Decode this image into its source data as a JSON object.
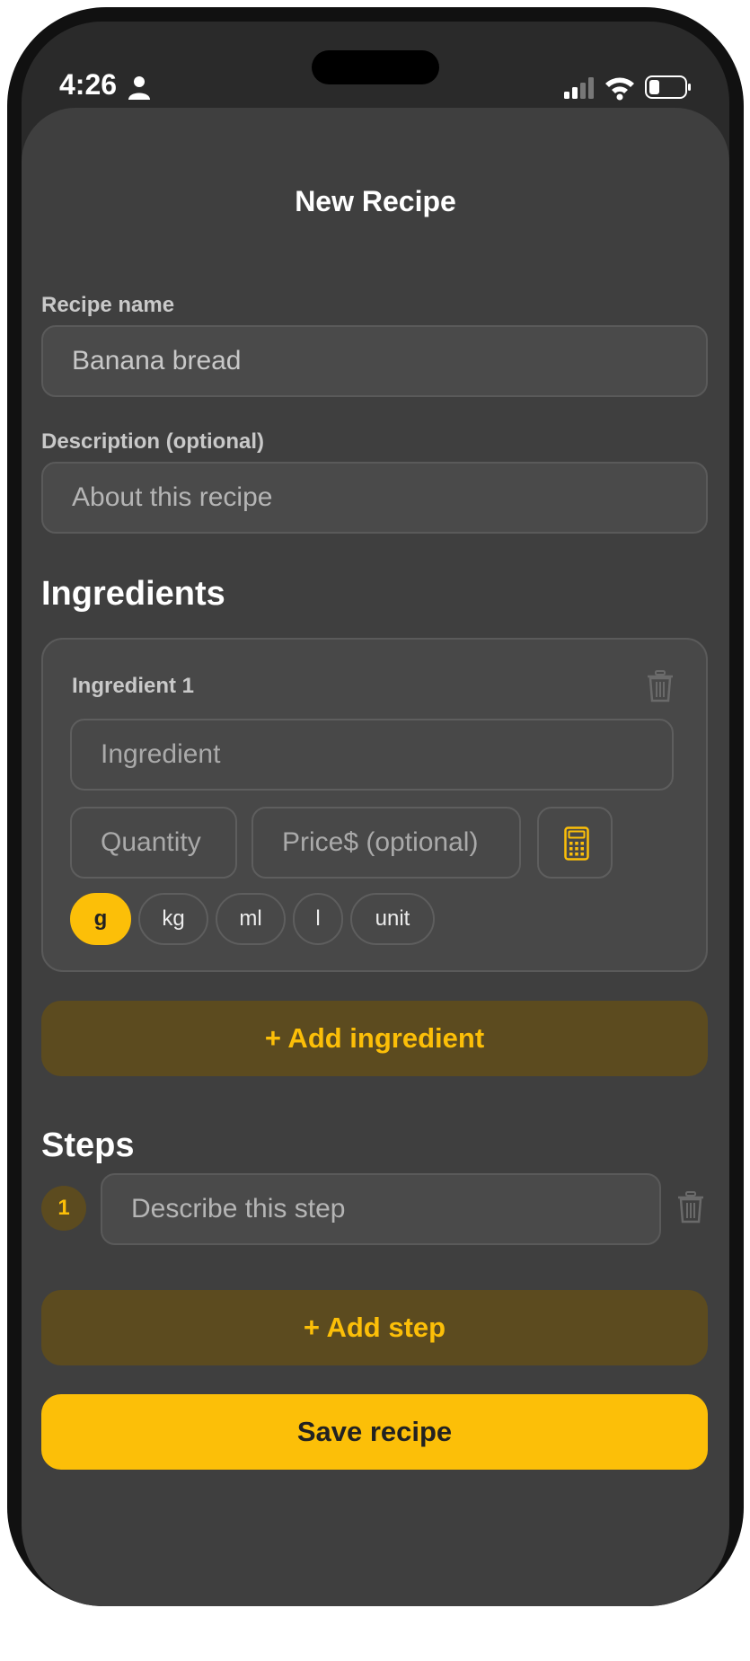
{
  "status_bar": {
    "time": "4:26"
  },
  "sheet": {
    "title": "New Recipe"
  },
  "recipe_name": {
    "label": "Recipe name",
    "value": "Banana bread"
  },
  "description": {
    "label": "Description (optional)",
    "placeholder": "About this recipe"
  },
  "ingredients": {
    "heading": "Ingredients",
    "items": [
      {
        "label": "Ingredient 1",
        "name_placeholder": "Ingredient",
        "quantity_placeholder": "Quantity",
        "price_placeholder": "Price$ (optional)",
        "units": [
          "g",
          "kg",
          "ml",
          "l",
          "unit"
        ],
        "selected_unit": "g"
      }
    ],
    "add_label": "+ Add ingredient"
  },
  "steps": {
    "heading": "Steps",
    "items": [
      {
        "number": "1",
        "placeholder": "Describe this step"
      }
    ],
    "add_label": "+ Add step"
  },
  "actions": {
    "save_label": "Save recipe"
  },
  "colors": {
    "accent": "#fcbf08",
    "accent_soft": "#5c4b1f",
    "sheet_bg": "#3f3f3f"
  }
}
